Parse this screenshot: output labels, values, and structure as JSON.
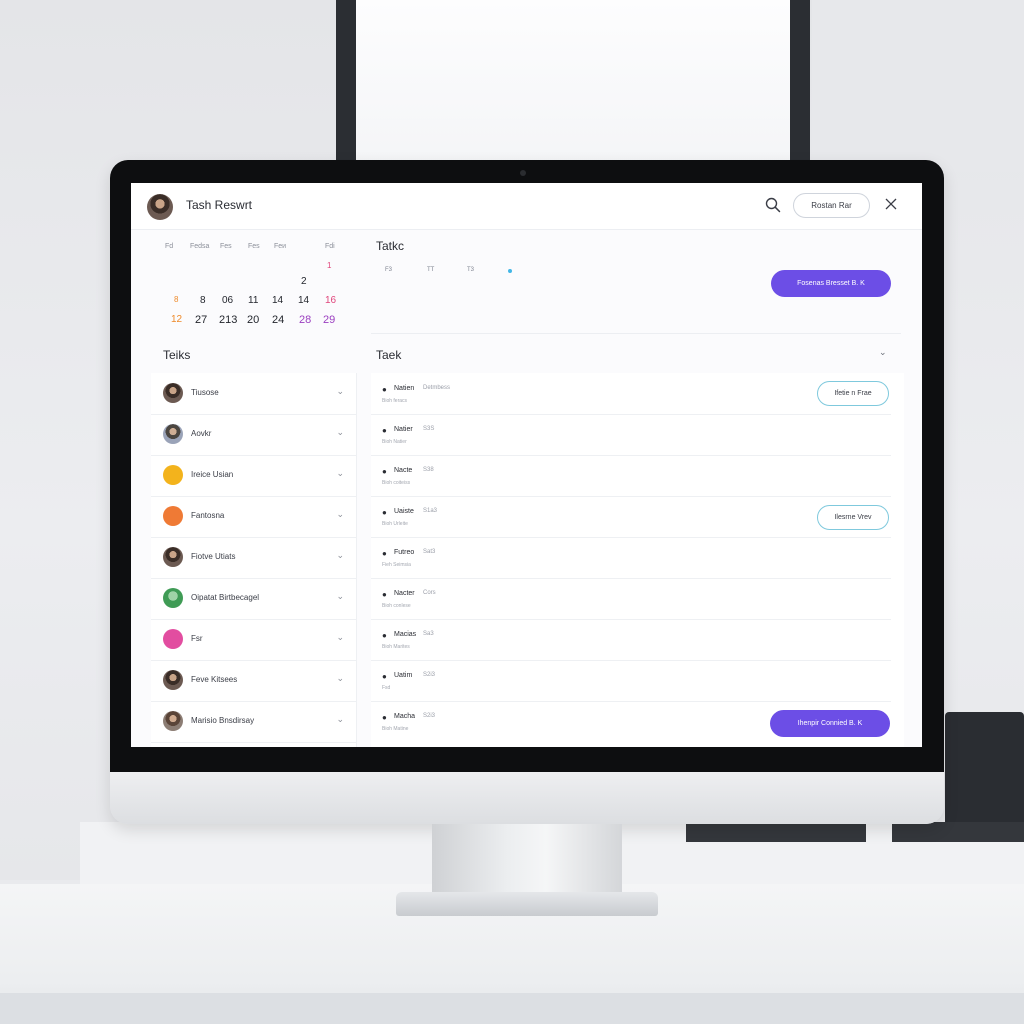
{
  "header": {
    "title": "Tash Reswrt",
    "action_button": "Rostan Rar"
  },
  "calendar": {
    "weekdays": [
      "Fd",
      "Fedsa",
      "Fes",
      "Fes",
      "Feи",
      "Fdi"
    ],
    "row1": [
      "2",
      "1"
    ],
    "row2": [
      "8",
      "8",
      "06",
      "11",
      "14",
      "14",
      "16"
    ],
    "row3": [
      "12",
      "27",
      "213",
      "20",
      "24",
      "28",
      "29"
    ]
  },
  "tasks_panel": {
    "title": "Tatkc",
    "columns": [
      "F3",
      "TT",
      "T3"
    ],
    "primary_button": "Fosenas Bresset B. K"
  },
  "left_section": {
    "title": "Teiks",
    "items": [
      {
        "label": "Tiusose"
      },
      {
        "label": "Aovkr"
      },
      {
        "label": "Ireice Usian"
      },
      {
        "label": "Fantosna"
      },
      {
        "label": "Fiotve Utiats"
      },
      {
        "label": "Oipatat Birtbecagel"
      },
      {
        "label": "Fsr"
      },
      {
        "label": "Feve Kitsees"
      },
      {
        "label": "Marisio Bnsdirsay"
      }
    ]
  },
  "task_section": {
    "title": "Taek",
    "rows": [
      {
        "name": "Natien",
        "code": "Detmbess",
        "sub": "Bioh feracs"
      },
      {
        "name": "Natier",
        "code": "S3S",
        "sub": "Bioh Natier"
      },
      {
        "name": "Nacte",
        "code": "S38",
        "sub": "Bioh coiteiss"
      },
      {
        "name": "Uaiste",
        "code": "S1a3",
        "sub": "Bioh Urleite"
      },
      {
        "name": "Futreo",
        "code": "Sat3",
        "sub": "Fieh Seimsia"
      },
      {
        "name": "Nacter",
        "code": "Cors",
        "sub": "Bioh conlese"
      },
      {
        "name": "Macias",
        "code": "Sa3",
        "sub": "Bioh Marites"
      },
      {
        "name": "Uatim",
        "code": "S2i3",
        "sub": "Fsd"
      },
      {
        "name": "Macha",
        "code": "S2i3",
        "sub": "Bioh Matine"
      }
    ],
    "row_actions": [
      "Ifetie n Frae",
      "Ilesrne Vrev"
    ],
    "bottom_button": "Ihenpir Connied B. K"
  },
  "colors": {
    "accent": "#6c4ee6",
    "outline_accent": "#7fc9dd",
    "dot": "#42b6e6",
    "calendar_pink": "#e0457b",
    "calendar_orange": "#ee8a2a",
    "calendar_purple": "#9b3fc0"
  }
}
